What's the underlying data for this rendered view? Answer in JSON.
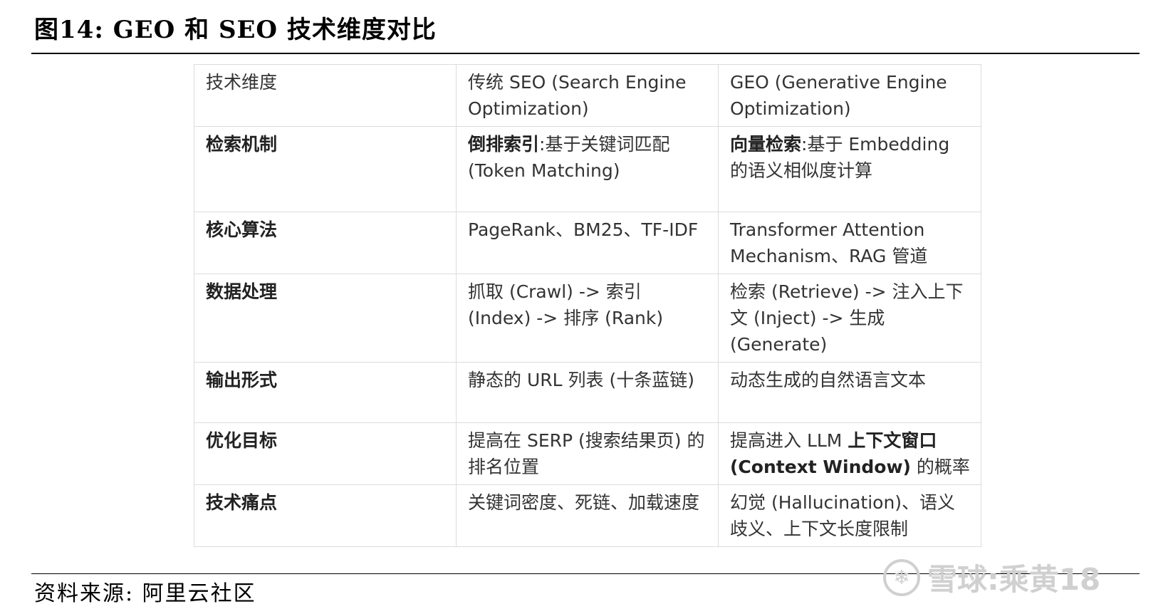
{
  "figure": {
    "title": "图14:  GEO 和 SEO 技术维度对比",
    "source": "资料来源:  阿里云社区",
    "watermark": "雪球:乘黄18"
  },
  "table": {
    "header": [
      "技术维度",
      "传统 SEO (Search Engine Optimization)",
      "GEO (Generative Engine Optimization)"
    ],
    "rows": [
      {
        "dimension": "检索机制",
        "seo_bold": "倒排索引",
        "seo_rest": ":基于关键词匹配 (Token Matching)",
        "geo_bold": "向量检索",
        "geo_rest": ":基于 Embedding 的语义相似度计算"
      },
      {
        "dimension": "核心算法",
        "seo": "PageRank、BM25、TF-IDF",
        "geo": "Transformer Attention Mechanism、RAG 管道"
      },
      {
        "dimension": "数据处理",
        "seo": "抓取 (Crawl) -> 索引 (Index) -> 排序 (Rank)",
        "geo": "检索 (Retrieve) -> 注入上下文 (Inject) -> 生成 (Generate)"
      },
      {
        "dimension": "输出形式",
        "seo": "静态的 URL 列表 (十条蓝链)",
        "geo": "动态生成的自然语言文本"
      },
      {
        "dimension": "优化目标",
        "seo": "提高在 SERP (搜索结果页) 的排名位置",
        "geo_pre": "提高进入 LLM ",
        "geo_bold": "上下文窗口 (Context Window)",
        "geo_post": " 的概率"
      },
      {
        "dimension": "技术痛点",
        "seo": "关键词密度、死链、加载速度",
        "geo": "幻觉 (Hallucination)、语义歧义、上下文长度限制"
      }
    ]
  }
}
